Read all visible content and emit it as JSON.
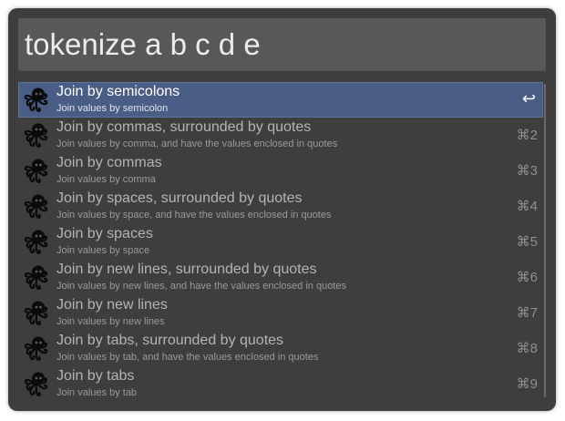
{
  "search": {
    "query": "tokenize a b c d e"
  },
  "results": [
    {
      "title": "Join by semicolons",
      "subtitle": "Join values by semicolon",
      "shortcut": "↩",
      "selected": true,
      "icon": "octopus-icon"
    },
    {
      "title": "Join by commas, surrounded by quotes",
      "subtitle": "Join values by comma, and have the values enclosed in quotes",
      "shortcut": "⌘2",
      "selected": false,
      "icon": "octopus-icon"
    },
    {
      "title": "Join by commas",
      "subtitle": "Join values by comma",
      "shortcut": "⌘3",
      "selected": false,
      "icon": "octopus-icon"
    },
    {
      "title": "Join by spaces, surrounded by quotes",
      "subtitle": "Join values by space, and have the values enclosed in quotes",
      "shortcut": "⌘4",
      "selected": false,
      "icon": "octopus-icon"
    },
    {
      "title": "Join by spaces",
      "subtitle": "Join values by space",
      "shortcut": "⌘5",
      "selected": false,
      "icon": "octopus-icon"
    },
    {
      "title": "Join by new lines, surrounded by quotes",
      "subtitle": "Join values by new lines, and have the values enclosed in quotes",
      "shortcut": "⌘6",
      "selected": false,
      "icon": "octopus-icon"
    },
    {
      "title": "Join by new lines",
      "subtitle": "Join values by new lines",
      "shortcut": "⌘7",
      "selected": false,
      "icon": "octopus-icon"
    },
    {
      "title": "Join by tabs, surrounded by quotes",
      "subtitle": "Join values by tab, and have the values enclosed in quotes",
      "shortcut": "⌘8",
      "selected": false,
      "icon": "octopus-icon"
    },
    {
      "title": "Join by tabs",
      "subtitle": "Join values by tab",
      "shortcut": "⌘9",
      "selected": false,
      "icon": "octopus-icon"
    }
  ],
  "colors": {
    "window_bg": "#3e3e3e",
    "search_bg": "#585858",
    "selection_bg": "#4a5d85"
  }
}
